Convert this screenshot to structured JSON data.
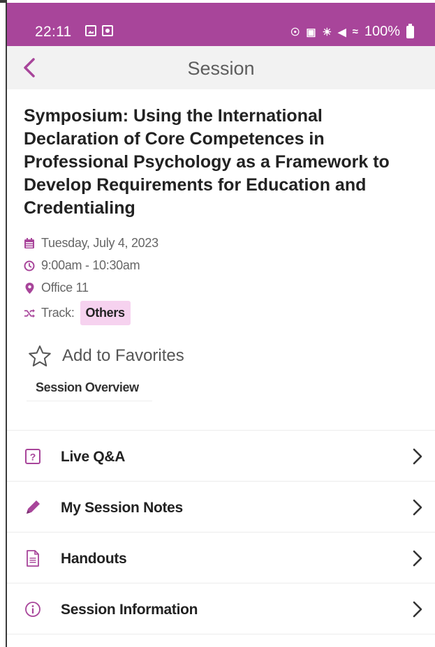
{
  "status_bar": {
    "time": "22:11",
    "battery": "100%",
    "color": "#a8459a"
  },
  "header": {
    "title": "Session",
    "back_icon": "chevron-left-icon",
    "accent": "#a8459a"
  },
  "session": {
    "title": "Symposium: Using the International Declaration of Core Competences in Professional Psychology as a Framework to Develop Requirements for Education and Credentialing",
    "date": "Tuesday, July 4, 2023",
    "time": "9:00am - 10:30am",
    "location": "Office 11",
    "track_label": "Track:",
    "track_value": "Others",
    "track_badge_color": "#f6d2ef"
  },
  "actions": {
    "favorite_label": "Add to Favorites",
    "overview_tab": "Session Overview"
  },
  "menu": [
    {
      "label": "Live Q&A",
      "icon": "question-box-icon"
    },
    {
      "label": "My Session Notes",
      "icon": "pencil-icon"
    },
    {
      "label": "Handouts",
      "icon": "document-icon"
    },
    {
      "label": "Session Information",
      "icon": "info-circle-icon"
    }
  ]
}
